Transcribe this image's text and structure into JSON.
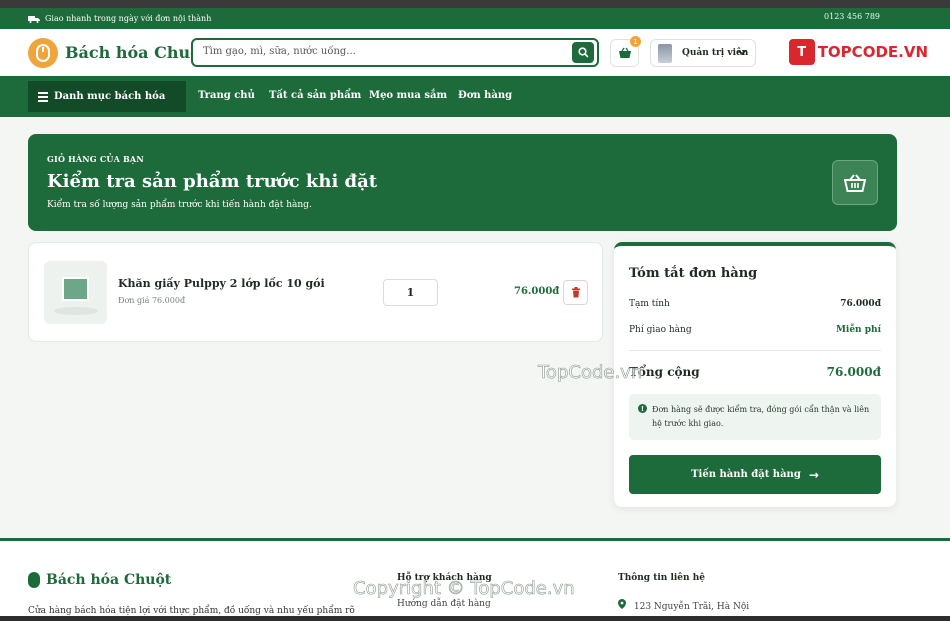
{
  "topbar": {
    "shipping_text": "Giao nhanh trong ngày với đơn nội thành",
    "phone_text": "0123 456 789"
  },
  "header": {
    "logo_text": "Bách hóa Chuột",
    "search_placeholder": "Tìm gạo, mì, sữa, nước uống...",
    "cart_count": "1",
    "user_name": "Quản trị viên"
  },
  "nav": {
    "category_label": "Danh mục bách hóa",
    "links": [
      "Trang chủ",
      "Tất cả sản phẩm",
      "Mẹo mua sắm",
      "Đơn hàng"
    ]
  },
  "watermark": {
    "logo_letter": "T",
    "logo_text": "TOPCODE.VN",
    "center_text": "TopCode.vn",
    "footer_text": "Copyright © TopCode.vn"
  },
  "hero": {
    "eyebrow": "GIỎ HÀNG CỦA BẠN",
    "title": "Kiểm tra sản phẩm trước khi đặt",
    "subtitle": "Kiểm tra số lượng sản phẩm trước khi tiến hành đặt hàng."
  },
  "cart": {
    "items": [
      {
        "name": "Khăn giấy Pulppy 2 lớp lốc 10 gói",
        "unit_price": "Đơn giá 76.000đ",
        "quantity": "1",
        "line_total": "76.000đ"
      }
    ]
  },
  "summary": {
    "title": "Tóm tắt đơn hàng",
    "subtotal_label": "Tạm tính",
    "subtotal_value": "76.000đ",
    "shipping_label": "Phí giao hàng",
    "shipping_value": "Miễn phí",
    "total_label": "Tổng cộng",
    "total_value": "76.000đ",
    "notice": "Đơn hàng sẽ được kiểm tra, đóng gói cẩn thận và liên hệ trước khi giao.",
    "checkout_label": "Tiến hành đặt hàng"
  },
  "footer": {
    "brand": "Bách hóa Chuột",
    "description": "Cửa hàng bách hóa tiện lợi với thực phẩm, đồ uống và nhu yếu phẩm rõ",
    "support_heading": "Hỗ trợ khách hàng",
    "support_link": "Hướng dẫn đặt hàng",
    "contact_heading": "Thông tin liên hệ",
    "address": "123 Nguyễn Trãi, Hà Nội"
  },
  "colors": {
    "brand_green": "#1d6a3a",
    "accent_orange": "#f0a53a",
    "watermark_red": "#d9272e"
  }
}
